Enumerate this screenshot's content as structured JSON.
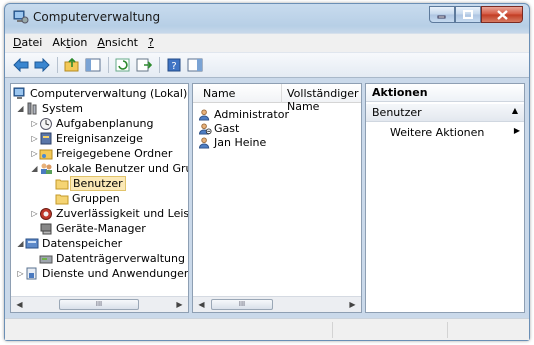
{
  "window": {
    "title": "Computerverwaltung"
  },
  "menu": [
    {
      "label": "Datei",
      "accel": "D"
    },
    {
      "label": "Aktion",
      "accel": "t"
    },
    {
      "label": "Ansicht",
      "accel": "A"
    },
    {
      "label": "?",
      "accel": "?"
    }
  ],
  "toolbar": [
    "back-icon",
    "forward-icon",
    "up-folder-icon",
    "show-hide-tree-icon",
    "refresh-icon",
    "export-list-icon",
    "help-icon",
    "show-hide-action-pane-icon"
  ],
  "tree": [
    {
      "label": "Computerverwaltung (Lokal)",
      "level": 0,
      "expander": "",
      "icon": "computer-management-icon"
    },
    {
      "label": "System",
      "level": 1,
      "expander": "◢",
      "icon": "system-tools-icon"
    },
    {
      "label": "Aufgabenplanung",
      "level": 2,
      "expander": "▷",
      "icon": "task-scheduler-icon"
    },
    {
      "label": "Ereignisanzeige",
      "level": 2,
      "expander": "▷",
      "icon": "event-viewer-icon"
    },
    {
      "label": "Freigegebene Ordner",
      "level": 2,
      "expander": "▷",
      "icon": "shared-folders-icon"
    },
    {
      "label": "Lokale Benutzer und Gruppen",
      "level": 2,
      "expander": "◢",
      "icon": "local-users-groups-icon"
    },
    {
      "label": "Benutzer",
      "level": 3,
      "expander": "",
      "icon": "folder-icon",
      "selected": true
    },
    {
      "label": "Gruppen",
      "level": 3,
      "expander": "",
      "icon": "folder-icon"
    },
    {
      "label": "Zuverlässigkeit und Leistung",
      "level": 2,
      "expander": "▷",
      "icon": "reliability-performance-icon"
    },
    {
      "label": "Geräte-Manager",
      "level": 2,
      "expander": "",
      "icon": "device-manager-icon"
    },
    {
      "label": "Datenspeicher",
      "level": 1,
      "expander": "◢",
      "icon": "storage-icon"
    },
    {
      "label": "Datenträgerverwaltung",
      "level": 2,
      "expander": "",
      "icon": "disk-management-icon"
    },
    {
      "label": "Dienste und Anwendungen",
      "level": 1,
      "expander": "▷",
      "icon": "services-applications-icon"
    }
  ],
  "list": {
    "columns": [
      "Name",
      "Vollständiger Name"
    ],
    "rows": [
      {
        "name": "Administrator",
        "icon": "user-icon"
      },
      {
        "name": "Gast",
        "icon": "user-disabled-icon"
      },
      {
        "name": "Jan Heine",
        "icon": "user-icon"
      }
    ]
  },
  "actions": {
    "header": "Aktionen",
    "section": "Benutzer",
    "items": [
      {
        "label": "Weitere Aktionen"
      }
    ]
  },
  "scroll": {
    "thumb_glyph": "III"
  }
}
